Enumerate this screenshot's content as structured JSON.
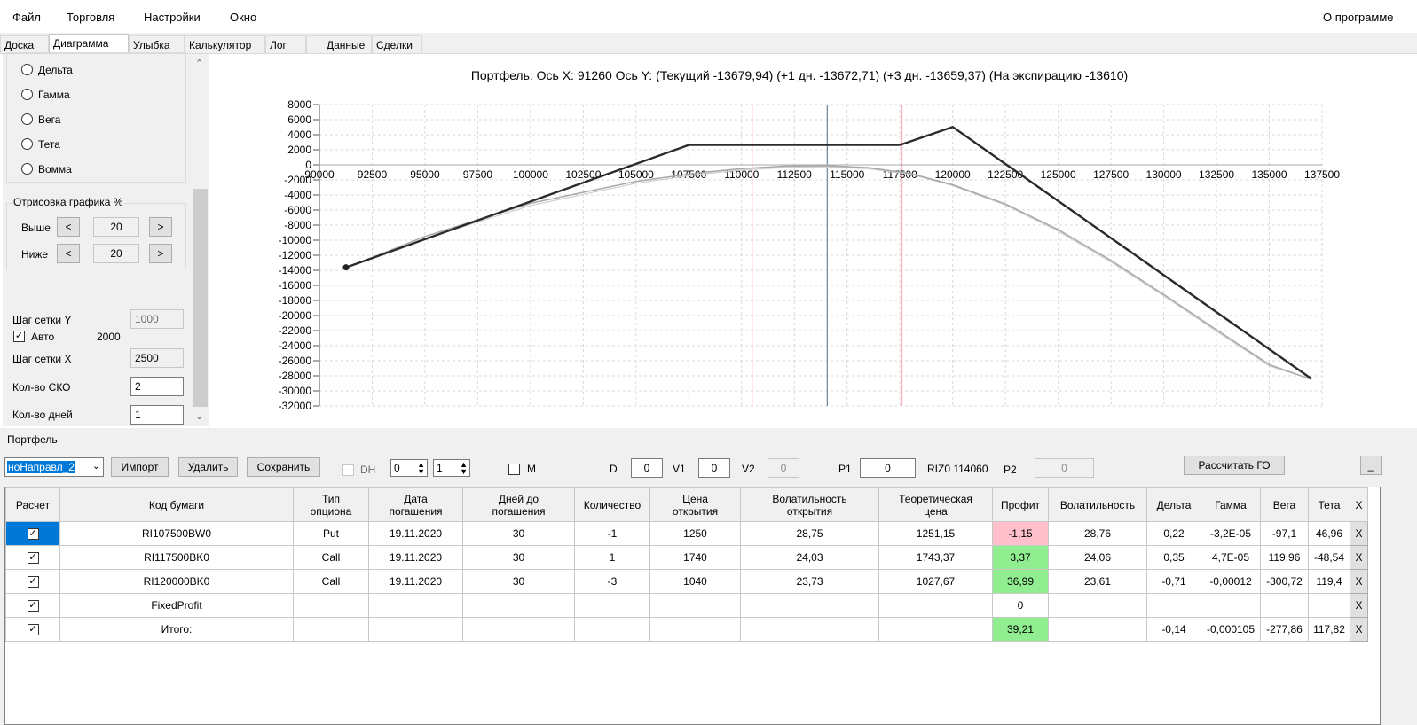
{
  "menu": {
    "file": "Файл",
    "trade": "Торговля",
    "settings": "Настройки",
    "window": "Окно",
    "about": "О программе"
  },
  "tabs": [
    "Доска",
    "Диаграмма",
    "Улыбка",
    "Калькулятор",
    "Лог",
    "Данные",
    "Сделки"
  ],
  "side": {
    "radios": [
      "Дельта",
      "Гамма",
      "Вега",
      "Тета",
      "Вомма"
    ],
    "draw_title": "Отрисовка графика %",
    "above_label": "Выше",
    "above_value": "20",
    "below_label": "Ниже",
    "below_value": "20",
    "prev_btn": "<",
    "next_btn": ">",
    "grid_y_label": "Шаг сетки Y",
    "grid_y_value": "1000",
    "auto_label": "Авто",
    "auto_value": "2000",
    "auto_checked": "✓",
    "grid_x_label": "Шаг сетки X",
    "grid_x_value": "2500",
    "sko_label": "Кол-во СКО",
    "sko_value": "2",
    "days_label": "Кол-во дней",
    "days_value": "1"
  },
  "chart_data": {
    "type": "line",
    "title": "Портфель: Ось X: 91260 Ось Y:  (Текущий -13679,94)  (+1 дн. -13672,71)  (+3 дн. -13659,37)  (На экспирацию -13610)",
    "xlim": [
      90000,
      137500
    ],
    "ylim": [
      -32000,
      8000
    ],
    "x_ticks": [
      "90000",
      "92500",
      "95000",
      "97500",
      "100000",
      "102500",
      "105000",
      "107500",
      "110000",
      "112500",
      "115000",
      "117500",
      "120000",
      "122500",
      "125000",
      "127500",
      "130000",
      "132500",
      "135000",
      "137500"
    ],
    "y_ticks": [
      "8000",
      "6000",
      "4000",
      "2000",
      "0",
      "-2000",
      "-4000",
      "-6000",
      "-8000",
      "-10000",
      "-12000",
      "-14000",
      "-16000",
      "-18000",
      "-20000",
      "-22000",
      "-24000",
      "-26000",
      "-28000",
      "-30000",
      "-32000"
    ],
    "grid": true,
    "vlines": [
      {
        "x": 110500,
        "color": "#ffb6c1"
      },
      {
        "x": 114060,
        "color": "#6f8fa8"
      },
      {
        "x": 117600,
        "color": "#ffb6c1"
      }
    ],
    "series": [
      {
        "color": "#2b2b2b",
        "width": 2.4,
        "x": [
          91260,
          107500,
          117500,
          120000,
          137000
        ],
        "y": [
          -13610,
          2640,
          2640,
          5040,
          -28400
        ]
      },
      {
        "color": "#a8a8a8",
        "width": 1.5,
        "x": [
          91260,
          95000,
          100000,
          105000,
          108000,
          110000,
          112000,
          114000,
          116000,
          118000,
          120000,
          122500,
          125000,
          127500,
          130000,
          132500,
          135000,
          137000
        ],
        "y": [
          -13680,
          -9500,
          -5100,
          -2200,
          -1050,
          -500,
          -180,
          -100,
          -370,
          -1150,
          -2650,
          -5200,
          -8600,
          -12700,
          -17200,
          -21900,
          -26500,
          -28500
        ]
      },
      {
        "color": "#cfcfcf",
        "width": 1.2,
        "x": [
          91260,
          95000,
          100000,
          105000,
          108000,
          110000,
          112000,
          114000,
          116000,
          118000,
          120000,
          122500,
          125000,
          127500,
          130000,
          132500,
          135000,
          137000
        ],
        "y": [
          -13672,
          -9750,
          -5400,
          -2450,
          -1250,
          -700,
          -350,
          -250,
          -500,
          -1250,
          -2750,
          -5350,
          -8800,
          -12900,
          -17400,
          -22100,
          -26700,
          -28400
        ]
      }
    ],
    "point": {
      "x": 91260,
      "y": -13610
    }
  },
  "portfolio": {
    "group_label": "Портфель",
    "combo_value": "ноНаправл_2",
    "import_btn": "Импорт",
    "delete_btn": "Удалить",
    "save_btn": "Сохранить",
    "dh_label": "DH",
    "dh_a": "0",
    "dh_b": "1",
    "m_label": "M",
    "d_label": "D",
    "d_value": "0",
    "v1_label": "V1",
    "v1_value": "0",
    "v2_label": "V2",
    "v2_value": "0",
    "p1_label": "P1",
    "p1_value": "0",
    "riz_label": "RIZ0 114060",
    "p2_label": "P2",
    "p2_value": "0",
    "calc_go_btn": "Рассчитать ГО",
    "min_btn": "_"
  },
  "table": {
    "headers": [
      "Расчет",
      "Код бумаги",
      "Тип\nопциона",
      "Дата\nпогашения",
      "Дней до\nпогашения",
      "Количество",
      "Цена\nоткрытия",
      "Волатильность\nоткрытия",
      "Теоретическая\nцена",
      "Профит",
      "Волатильность",
      "Дельта",
      "Гамма",
      "Вега",
      "Тета",
      "X"
    ],
    "check": "✓",
    "x": "X",
    "rows": [
      {
        "code": "RI107500BW0",
        "type": "Put",
        "date": "19.11.2020",
        "days": "30",
        "qty": "-1",
        "open": "1250",
        "vol_open": "28,75",
        "theo": "1251,15",
        "profit": "-1,15",
        "vol": "28,76",
        "delta": "0,22",
        "gamma": "-3,2E-05",
        "vega": "-97,1",
        "theta": "46,96",
        "profit_color": "#ffc0cb"
      },
      {
        "code": "RI117500BK0",
        "type": "Call",
        "date": "19.11.2020",
        "days": "30",
        "qty": "1",
        "open": "1740",
        "vol_open": "24,03",
        "theo": "1743,37",
        "profit": "3,37",
        "vol": "24,06",
        "delta": "0,35",
        "gamma": "4,7E-05",
        "vega": "119,96",
        "theta": "-48,54",
        "profit_color": "#90ee90"
      },
      {
        "code": "RI120000BK0",
        "type": "Call",
        "date": "19.11.2020",
        "days": "30",
        "qty": "-3",
        "open": "1040",
        "vol_open": "23,73",
        "theo": "1027,67",
        "profit": "36,99",
        "vol": "23,61",
        "delta": "-0,71",
        "gamma": "-0,00012",
        "vega": "-300,72",
        "theta": "119,4",
        "profit_color": "#90ee90"
      },
      {
        "code": "FixedProfit",
        "type": "",
        "date": "",
        "days": "",
        "qty": "",
        "open": "",
        "vol_open": "",
        "theo": "",
        "profit": "0",
        "vol": "",
        "delta": "",
        "gamma": "",
        "vega": "",
        "theta": "",
        "profit_color": "#ffffff"
      },
      {
        "code": "Итого:",
        "type": "",
        "date": "",
        "days": "",
        "qty": "",
        "open": "",
        "vol_open": "",
        "theo": "",
        "profit": "39,21",
        "vol": "",
        "delta": "-0,14",
        "gamma": "-0,000105",
        "vega": "-277,86",
        "theta": "117,82",
        "profit_color": "#90ee90"
      }
    ]
  }
}
